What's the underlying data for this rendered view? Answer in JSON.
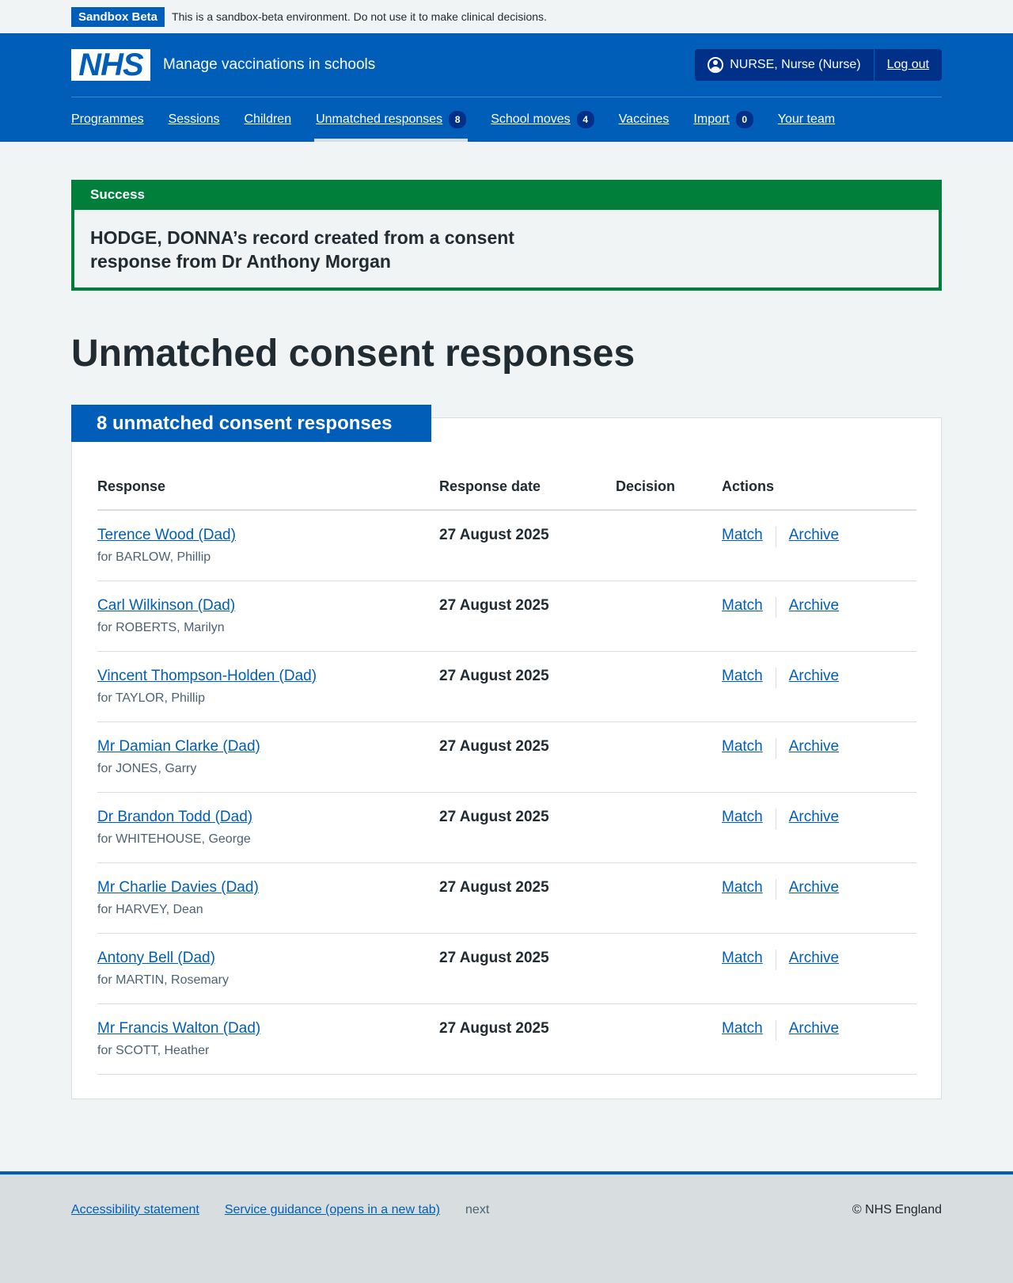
{
  "sandbox": {
    "tag": "Sandbox Beta",
    "message": "This is a sandbox-beta environment. Do not use it to make clinical decisions."
  },
  "header": {
    "logo_text": "NHS",
    "service_name": "Manage vaccinations in schools",
    "user": "NURSE, Nurse (Nurse)",
    "logout": "Log out"
  },
  "nav": {
    "items": [
      {
        "label": "Programmes"
      },
      {
        "label": "Sessions"
      },
      {
        "label": "Children"
      },
      {
        "label": "Unmatched responses",
        "count": "8",
        "current": true
      },
      {
        "label": "School moves",
        "count": "4"
      },
      {
        "label": "Vaccines"
      },
      {
        "label": "Import",
        "count": "0"
      },
      {
        "label": "Your team"
      }
    ]
  },
  "success": {
    "title": "Success",
    "message": "HODGE, DONNA’s record created from a consent response from Dr Anthony Morgan"
  },
  "page_title": "Unmatched consent responses",
  "card": {
    "heading": "8 unmatched consent responses",
    "columns": [
      "Response",
      "Response date",
      "Decision",
      "Actions"
    ],
    "rows": [
      {
        "name": "Terence Wood (Dad)",
        "for": "for BARLOW, Phillip",
        "date": "27 August 2025",
        "decision": "",
        "match": "Match",
        "archive": "Archive"
      },
      {
        "name": "Carl Wilkinson (Dad)",
        "for": "for ROBERTS, Marilyn",
        "date": "27 August 2025",
        "decision": "",
        "match": "Match",
        "archive": "Archive"
      },
      {
        "name": "Vincent Thompson-Holden (Dad)",
        "for": "for TAYLOR, Phillip",
        "date": "27 August 2025",
        "decision": "",
        "match": "Match",
        "archive": "Archive"
      },
      {
        "name": "Mr Damian Clarke (Dad)",
        "for": "for JONES, Garry",
        "date": "27 August 2025",
        "decision": "",
        "match": "Match",
        "archive": "Archive"
      },
      {
        "name": "Dr Brandon Todd (Dad)",
        "for": "for WHITEHOUSE, George",
        "date": "27 August 2025",
        "decision": "",
        "match": "Match",
        "archive": "Archive"
      },
      {
        "name": "Mr Charlie Davies (Dad)",
        "for": "for HARVEY, Dean",
        "date": "27 August 2025",
        "decision": "",
        "match": "Match",
        "archive": "Archive"
      },
      {
        "name": "Antony Bell (Dad)",
        "for": "for MARTIN, Rosemary",
        "date": "27 August 2025",
        "decision": "",
        "match": "Match",
        "archive": "Archive"
      },
      {
        "name": "Mr Francis Walton (Dad)",
        "for": "for SCOTT, Heather",
        "date": "27 August 2025",
        "decision": "",
        "match": "Match",
        "archive": "Archive"
      }
    ]
  },
  "footer": {
    "links": [
      "Accessibility statement",
      "Service guidance (opens in a new tab)"
    ],
    "version": "next",
    "copyright": "© NHS England"
  }
}
